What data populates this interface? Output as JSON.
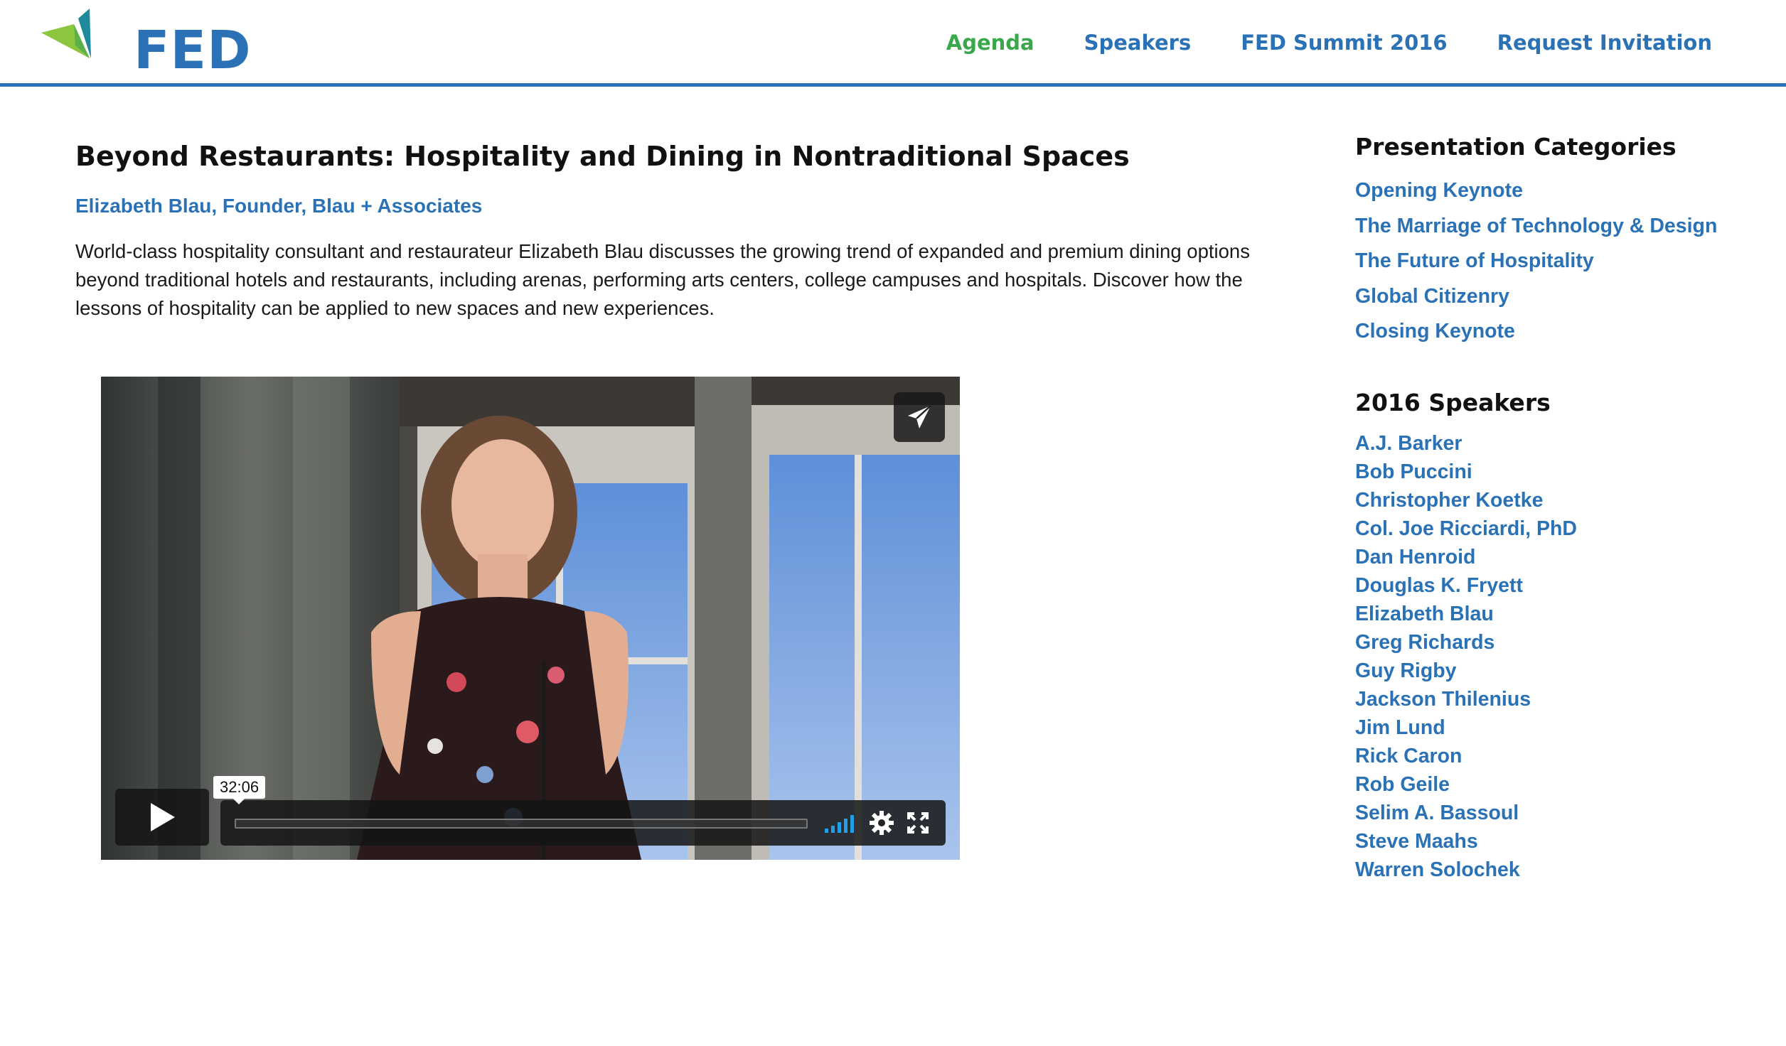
{
  "header": {
    "logo_text": "FED",
    "nav": [
      {
        "label": "Agenda",
        "active": true
      },
      {
        "label": "Speakers",
        "active": false
      },
      {
        "label": "FED Summit 2016",
        "active": false
      },
      {
        "label": "Request Invitation",
        "active": false
      }
    ]
  },
  "main": {
    "title": "Beyond Restaurants: Hospitality and Dining in Nontraditional Spaces",
    "byline": "Elizabeth Blau, Founder, Blau + Associates",
    "description": "World-class hospitality consultant and restaurateur Elizabeth Blau discusses the growing trend of expanded and premium dining options beyond traditional hotels and restaurants, including arenas, performing arts centers, college campuses and hospitals. Discover how the lessons of hospitality can be applied to new spaces and new experiences."
  },
  "video": {
    "duration": "32:06",
    "progress": 0,
    "icons": [
      "send-icon",
      "play-icon",
      "volume-icon",
      "gear-icon",
      "fullscreen-icon"
    ]
  },
  "sidebar": {
    "categories_heading": "Presentation Categories",
    "categories": [
      "Opening Keynote",
      "The Marriage of Technology & Design",
      "The Future of Hospitality",
      "Global Citizenry",
      "Closing Keynote"
    ],
    "speakers_heading": "2016 Speakers",
    "speakers": [
      "A.J. Barker",
      "Bob Puccini",
      "Christopher Koetke",
      "Col. Joe Ricciardi, PhD",
      "Dan Henroid",
      "Douglas K. Fryett",
      "Elizabeth Blau",
      "Greg Richards",
      "Guy Rigby",
      "Jackson Thilenius",
      "Jim Lund",
      "Rick Caron",
      "Rob Geile",
      "Selim A. Bassoul",
      "Steve Maahs",
      "Warren Solochek"
    ]
  },
  "colors": {
    "brand_blue": "#2a72b5",
    "active_green": "#3aa84a",
    "logo_green": "#8cc63f",
    "logo_teal": "#1a9a9a"
  }
}
